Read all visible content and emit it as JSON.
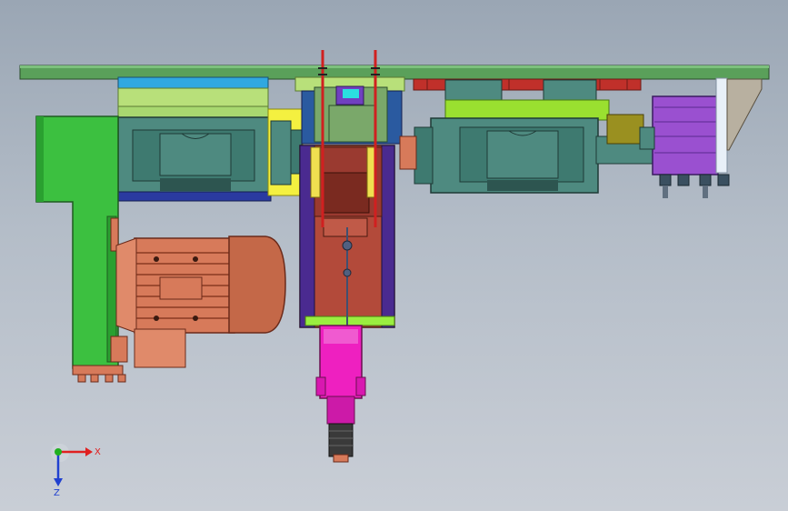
{
  "viewport": {
    "background_top": "#9aa6b4",
    "background_bottom": "#c9ced6"
  },
  "triad": {
    "x_label": "X",
    "z_label": "Z",
    "x_color": "#e02020",
    "y_color": "#20b020",
    "z_color": "#2040d0"
  },
  "colors": {
    "top_plate": "#5aa05a",
    "spindle_teal": "#4e8a80",
    "bracket_green": "#3cc040",
    "motor_orange": "#d77a5a",
    "slide_brown": "#b34a3a",
    "cylinder_magenta": "#ee20c0",
    "cylinder_purple": "#9a50d0",
    "accent_yellow": "#f4f040",
    "accent_blue": "#30a8e0"
  }
}
